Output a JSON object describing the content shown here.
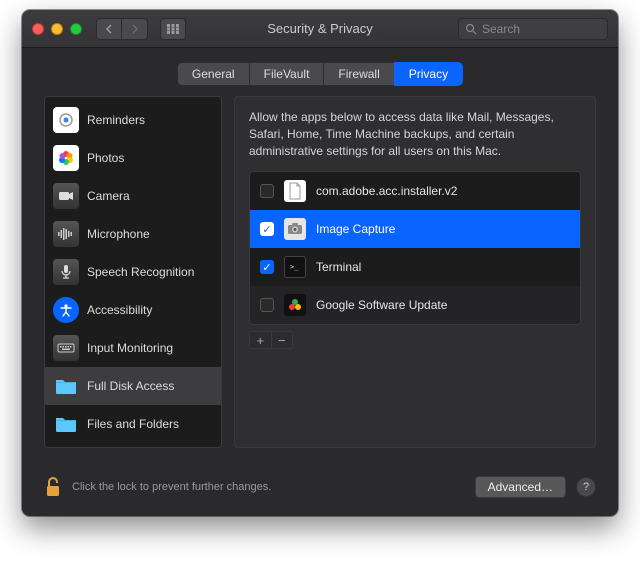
{
  "window": {
    "title": "Security & Privacy",
    "search_placeholder": "Search"
  },
  "tabs": [
    {
      "label": "General",
      "active": false
    },
    {
      "label": "FileVault",
      "active": false
    },
    {
      "label": "Firewall",
      "active": false
    },
    {
      "label": "Privacy",
      "active": true
    }
  ],
  "sidebar": {
    "items": [
      {
        "label": "Reminders"
      },
      {
        "label": "Photos"
      },
      {
        "label": "Camera"
      },
      {
        "label": "Microphone"
      },
      {
        "label": "Speech Recognition"
      },
      {
        "label": "Accessibility"
      },
      {
        "label": "Input Monitoring"
      },
      {
        "label": "Full Disk Access"
      },
      {
        "label": "Files and Folders"
      }
    ],
    "selected_index": 7
  },
  "main": {
    "description": "Allow the apps below to access data like Mail, Messages, Safari, Home, Time Machine backups, and certain administrative settings for all users on this Mac.",
    "apps": [
      {
        "name": "com.adobe.acc.installer.v2",
        "checked": false,
        "selected": false
      },
      {
        "name": "Image Capture",
        "checked": true,
        "selected": true
      },
      {
        "name": "Terminal",
        "checked": true,
        "selected": false
      },
      {
        "name": "Google Software Update",
        "checked": false,
        "selected": false
      }
    ]
  },
  "footer": {
    "lock_text": "Click the lock to prevent further changes.",
    "advanced_label": "Advanced…"
  }
}
